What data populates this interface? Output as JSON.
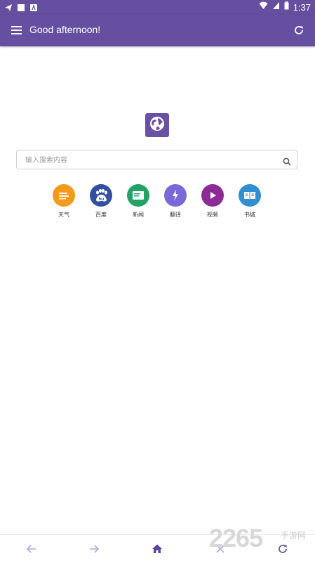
{
  "status_bar": {
    "time": "1:37"
  },
  "toolbar": {
    "title": "Good afternoon!"
  },
  "search": {
    "placeholder": "输入搜索内容"
  },
  "shortcuts": [
    {
      "label": "天气",
      "color": "#f39a1b",
      "icon": "weather-icon"
    },
    {
      "label": "百度",
      "color": "#3150a0",
      "icon": "baidu-icon"
    },
    {
      "label": "新闻",
      "color": "#22a366",
      "icon": "news-icon"
    },
    {
      "label": "翻译",
      "color": "#7a68d8",
      "icon": "translate-icon"
    },
    {
      "label": "视频",
      "color": "#8e2a96",
      "icon": "video-icon"
    },
    {
      "label": "书城",
      "color": "#2f8fd0",
      "icon": "book-icon"
    }
  ],
  "colors": {
    "primary": "#664fa0",
    "nav_icon": "#b3a6df"
  },
  "watermark": {
    "number": "2265",
    "text": "手游网"
  }
}
